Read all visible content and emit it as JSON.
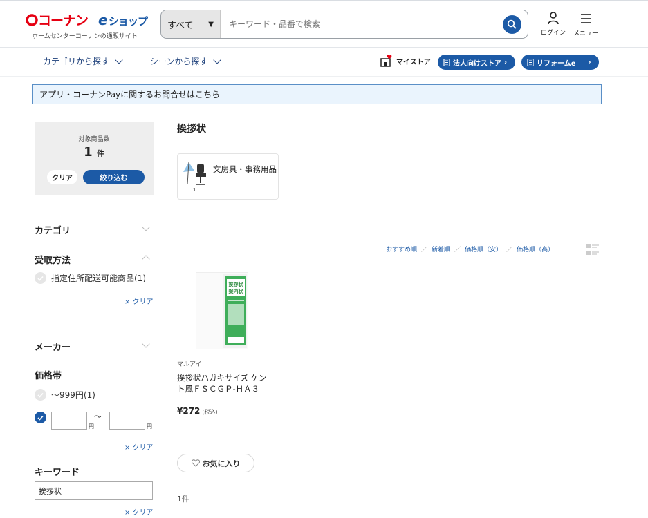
{
  "header": {
    "logo_text": "コーナンeショップ",
    "tagline": "ホームセンターコーナンの通販サイト",
    "search": {
      "category": "すべて",
      "placeholder": "キーワード・品番で検索"
    },
    "login_label": "ログイン",
    "menu_label": "メニュー"
  },
  "subnav": {
    "category_link": "カテゴリから探す",
    "scene_link": "シーンから探す",
    "mystore": "マイストア",
    "corporate": "法人向けストア",
    "reform": "リフォームe"
  },
  "notice": "アプリ・コーナンPayに関するお問合せはこちら",
  "filters": {
    "count_label": "対象商品数",
    "count_value": "1",
    "count_unit": "件",
    "clear": "クリア",
    "refine": "絞り込む",
    "category": "カテゴリ",
    "pickup": "受取方法",
    "pickup_option": "指定住所配送可能商品(1)",
    "clear_link": "クリア",
    "maker": "メーカー",
    "price": "価格帯",
    "price_option": "～999円(1)",
    "price_tilde": "～",
    "yen": "円",
    "keyword": "キーワード",
    "keyword_value": "挨拶状"
  },
  "main": {
    "title": "挨拶状",
    "category_card": {
      "label": "文房具・事務用品",
      "thumb_num": "1"
    },
    "sort": [
      "おすすめ順",
      "新着順",
      "価格順（安）",
      "価格順（高）"
    ],
    "sort_sep": "／",
    "product": {
      "brand": "マルアイ",
      "name": "挨拶状ハガキサイズ ケント風ＦＳＣＧＰ-ＨＡ３",
      "price": "¥272",
      "tax": "(税込)",
      "package_text": [
        "挨拶状",
        "案内状"
      ]
    },
    "favorite": "お気に入り",
    "result_count": "1件"
  },
  "colors": {
    "brand_red": "#e60012",
    "brand_blue": "#1c5aa6",
    "notice_bg": "#eaf4fd"
  }
}
